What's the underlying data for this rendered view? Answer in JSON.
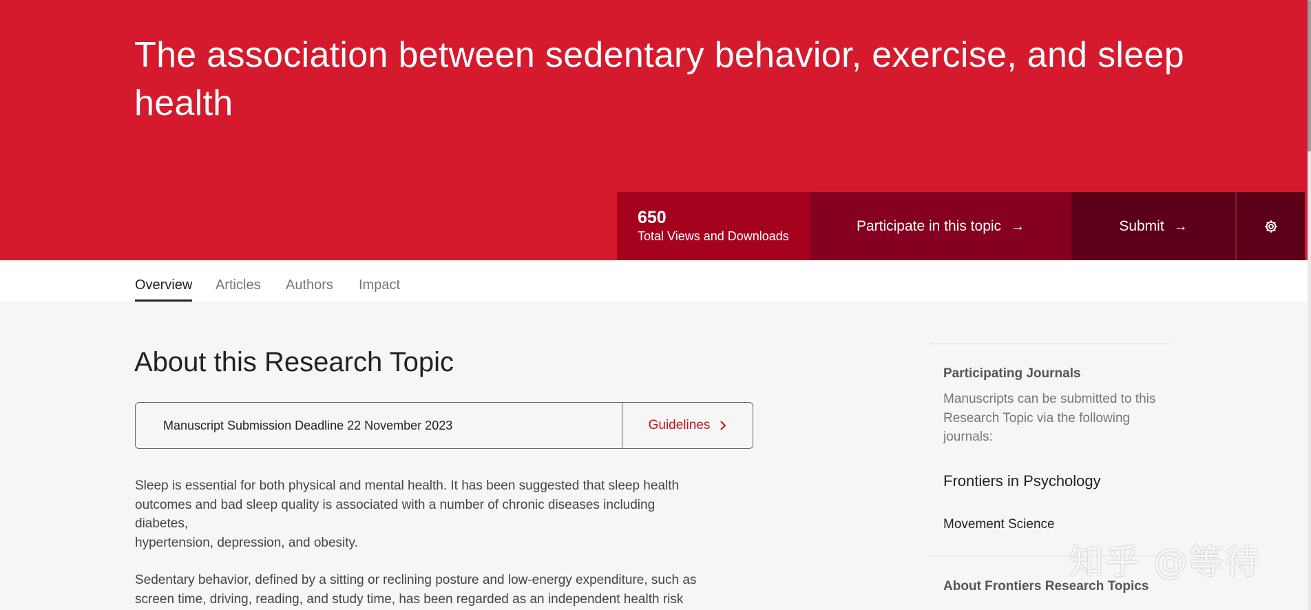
{
  "hero": {
    "title": "The association between sedentary behavior, exercise, and sleep health"
  },
  "stats": {
    "value": "650",
    "label": "Total Views and Downloads"
  },
  "actions": {
    "participate_label": "Participate in this topic",
    "submit_label": "Submit"
  },
  "icons": {
    "arrow": "arrow-right-icon",
    "chevron": "chevron-right-icon",
    "settings": "gear-icon"
  },
  "tabs": [
    {
      "label": "Overview",
      "active": true
    },
    {
      "label": "Articles",
      "active": false
    },
    {
      "label": "Authors",
      "active": false
    },
    {
      "label": "Impact",
      "active": false
    }
  ],
  "main": {
    "section_title": "About this Research Topic",
    "deadline": "Manuscript Submission Deadline 22 November 2023",
    "guidelines_label": "Guidelines",
    "paragraph1_lines": [
      "Sleep is essential for both physical and mental health. It has been suggested that sleep health",
      "outcomes and bad sleep quality is associated with a number of chronic diseases including",
      "diabetes,",
      "hypertension, depression, and obesity."
    ],
    "paragraph2_lines": [
      "Sedentary behavior, defined by a sitting or reclining posture and low-energy expenditure, such as",
      "screen time, driving, reading, and study time, has been regarded as an independent health risk"
    ]
  },
  "sidebar": {
    "participating_heading": "Participating Journals",
    "participating_text": "Manuscripts can be submitted to this Research Topic via the following journals:",
    "journal_name": "Frontiers in Psychology",
    "journal_section": "Movement Science",
    "about_heading": "About Frontiers Research Topics"
  },
  "watermark": {
    "text": "知乎 @等待"
  },
  "colors": {
    "brand_red": "#d41a2c",
    "stat_bg": "#a5031d",
    "participate_bg": "#860021",
    "submit_bg": "#5c0019",
    "link_red": "#c0121f"
  }
}
